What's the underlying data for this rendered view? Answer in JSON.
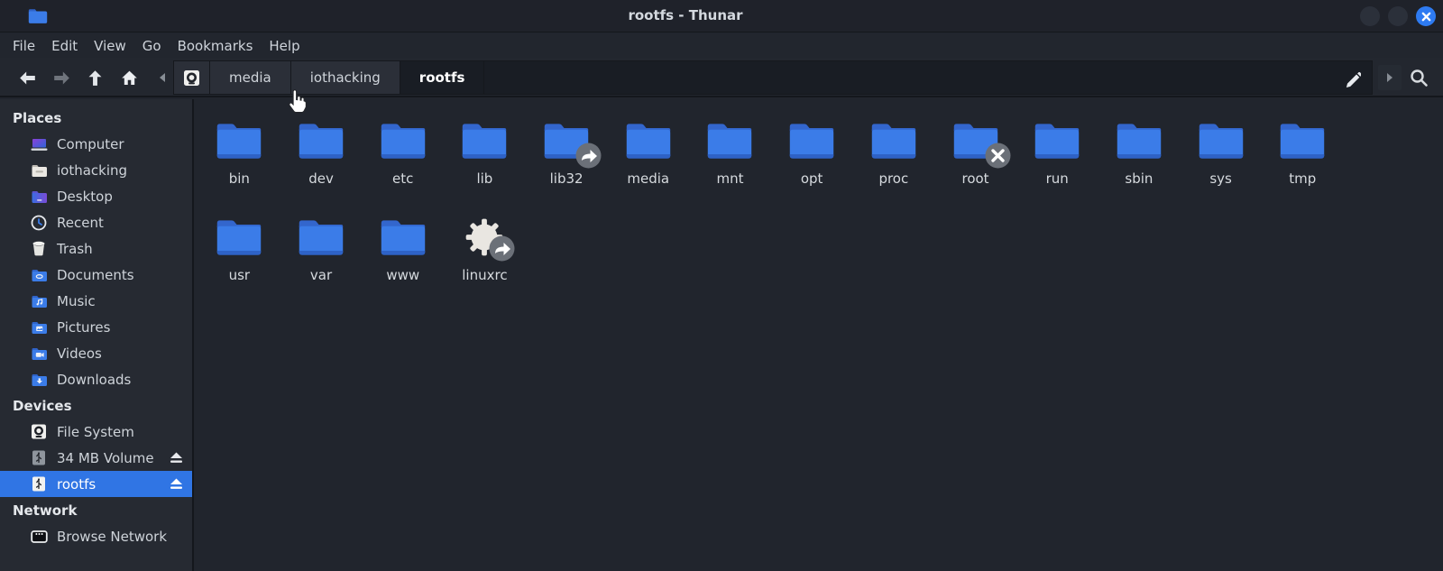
{
  "window": {
    "title": "rootfs - Thunar"
  },
  "menu": {
    "items": [
      "File",
      "Edit",
      "View",
      "Go",
      "Bookmarks",
      "Help"
    ]
  },
  "toolbar": {
    "breadcrumbs": [
      "media",
      "iothacking",
      "rootfs"
    ],
    "active_breadcrumb": "rootfs",
    "icons": [
      "back-icon",
      "forward-icon",
      "up-icon",
      "home-icon",
      "filesystem-root-icon",
      "edit-path-icon",
      "search-icon"
    ]
  },
  "sidebar": {
    "places": {
      "header": "Places",
      "items": [
        {
          "label": "Computer",
          "icon": "computer-icon"
        },
        {
          "label": "iothacking",
          "icon": "home-folder-icon"
        },
        {
          "label": "Desktop",
          "icon": "desktop-folder-icon"
        },
        {
          "label": "Recent",
          "icon": "recent-clock-icon"
        },
        {
          "label": "Trash",
          "icon": "trash-icon"
        },
        {
          "label": "Documents",
          "icon": "documents-folder-icon"
        },
        {
          "label": "Music",
          "icon": "music-folder-icon"
        },
        {
          "label": "Pictures",
          "icon": "pictures-folder-icon"
        },
        {
          "label": "Videos",
          "icon": "videos-folder-icon"
        },
        {
          "label": "Downloads",
          "icon": "downloads-folder-icon"
        }
      ]
    },
    "devices": {
      "header": "Devices",
      "items": [
        {
          "label": "File System",
          "icon": "harddisk-icon",
          "ejectable": false,
          "selected": false
        },
        {
          "label": "34 MB Volume",
          "icon": "usb-drive-icon",
          "ejectable": true,
          "selected": false
        },
        {
          "label": "rootfs",
          "icon": "usb-drive-icon",
          "ejectable": true,
          "selected": true
        }
      ]
    },
    "network": {
      "header": "Network",
      "items": [
        {
          "label": "Browse Network",
          "icon": "network-icon"
        }
      ]
    }
  },
  "files": [
    {
      "name": "bin",
      "icon": "folder",
      "emblem": ""
    },
    {
      "name": "dev",
      "icon": "folder",
      "emblem": ""
    },
    {
      "name": "etc",
      "icon": "folder",
      "emblem": ""
    },
    {
      "name": "lib",
      "icon": "folder",
      "emblem": ""
    },
    {
      "name": "lib32",
      "icon": "folder",
      "emblem": "symlink"
    },
    {
      "name": "media",
      "icon": "folder",
      "emblem": ""
    },
    {
      "name": "mnt",
      "icon": "folder",
      "emblem": ""
    },
    {
      "name": "opt",
      "icon": "folder",
      "emblem": ""
    },
    {
      "name": "proc",
      "icon": "folder",
      "emblem": ""
    },
    {
      "name": "root",
      "icon": "folder",
      "emblem": "no-access"
    },
    {
      "name": "run",
      "icon": "folder",
      "emblem": ""
    },
    {
      "name": "sbin",
      "icon": "folder",
      "emblem": ""
    },
    {
      "name": "sys",
      "icon": "folder",
      "emblem": ""
    },
    {
      "name": "tmp",
      "icon": "folder",
      "emblem": ""
    },
    {
      "name": "usr",
      "icon": "folder",
      "emblem": ""
    },
    {
      "name": "var",
      "icon": "folder",
      "emblem": ""
    },
    {
      "name": "www",
      "icon": "folder",
      "emblem": ""
    },
    {
      "name": "linuxrc",
      "icon": "gear",
      "emblem": "symlink"
    }
  ],
  "colors": {
    "accent_selection": "#3075e4",
    "folder_blue": "#3b7ce8",
    "close_button_blue": "#2e7bf2",
    "window_chrome": "#22262e",
    "main_background": "#21252d"
  }
}
